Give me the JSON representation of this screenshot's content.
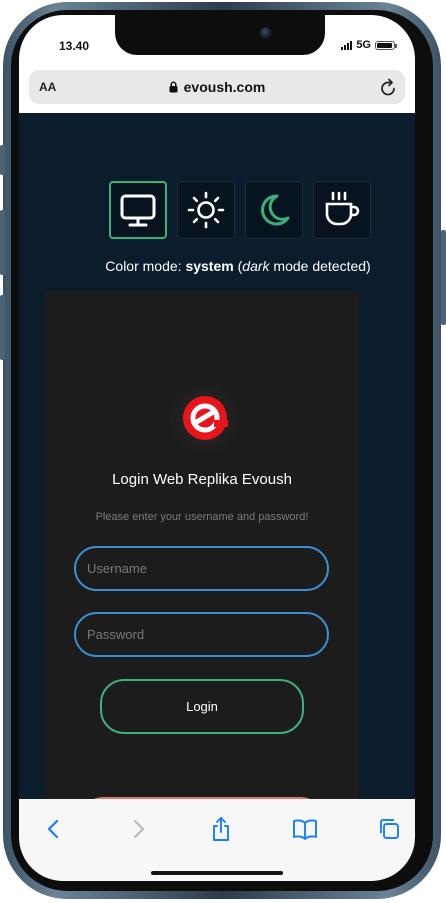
{
  "status": {
    "time": "13.40",
    "network": "5G"
  },
  "browser": {
    "aa_label": "AA",
    "url": "evoush.com"
  },
  "color_mode": {
    "options": [
      "system",
      "light",
      "dark",
      "sepia"
    ],
    "caption_prefix": "Color mode: ",
    "mode": "system",
    "caption_open": " (",
    "detected": "dark",
    "caption_suffix": " mode detected)"
  },
  "login": {
    "title": "Login Web Replika Evoush",
    "subtitle": "Please enter your username and password!",
    "username_placeholder": "Username",
    "password_placeholder": "Password",
    "login_label": "Login"
  },
  "colors": {
    "page_bg": "#0b1c2c",
    "card_bg": "#1c1c1c",
    "accent_green": "#3bb07a",
    "accent_blue": "#3a8fd0",
    "logo_red": "#e8141c",
    "ios_blue": "#1a7cff"
  }
}
